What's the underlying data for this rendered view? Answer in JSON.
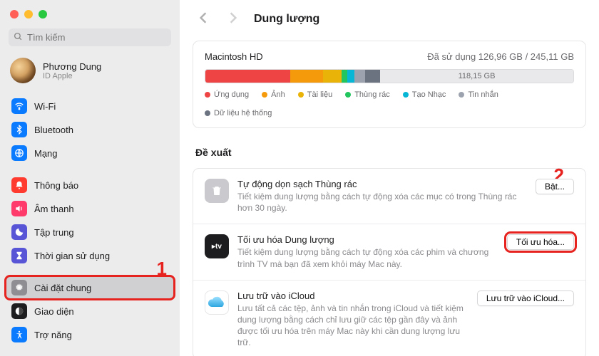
{
  "colors": {
    "red": "#ef4444",
    "orange": "#f59b0b",
    "yellow": "#eab308",
    "green": "#22c55e",
    "teal": "#06b6d4",
    "gray": "#9ca3af",
    "darkgray": "#6b7280"
  },
  "search": {
    "placeholder": "Tìm kiếm"
  },
  "account": {
    "name": "Phương Dung",
    "sub": "ID Apple"
  },
  "sidebar": {
    "items": [
      {
        "label": "Wi-Fi",
        "icon": "wifi",
        "bg": "#0a7aff"
      },
      {
        "label": "Bluetooth",
        "icon": "bluetooth",
        "bg": "#0a7aff"
      },
      {
        "label": "Mạng",
        "icon": "globe",
        "bg": "#0a7aff"
      },
      {
        "gap": true
      },
      {
        "label": "Thông báo",
        "icon": "bell",
        "bg": "#ff3b30"
      },
      {
        "label": "Âm thanh",
        "icon": "speaker",
        "bg": "#ff3b6b"
      },
      {
        "label": "Tập trung",
        "icon": "moon",
        "bg": "#5856d6"
      },
      {
        "label": "Thời gian sử dụng",
        "icon": "hourglass",
        "bg": "#5856d6"
      },
      {
        "gap": true
      },
      {
        "label": "Cài đặt chung",
        "icon": "gear",
        "bg": "#8e8e93",
        "selected": true,
        "highlight": true
      },
      {
        "label": "Giao diện",
        "icon": "appearance",
        "bg": "#1d1d1f"
      },
      {
        "label": "Trợ năng",
        "icon": "accessibility",
        "bg": "#0a7aff"
      }
    ]
  },
  "header": {
    "title": "Dung lượng"
  },
  "disk": {
    "name": "Macintosh HD",
    "used": "Đã sử dụng 126,96 GB / 245,11 GB",
    "free": "118,15 GB",
    "segments": [
      {
        "w": 23,
        "c": "#ef4444"
      },
      {
        "w": 9,
        "c": "#f59b0b"
      },
      {
        "w": 5,
        "c": "#eab308"
      },
      {
        "w": 1.5,
        "c": "#22c55e"
      },
      {
        "w": 2,
        "c": "#06b6d4"
      },
      {
        "w": 3,
        "c": "#9ca3af"
      },
      {
        "w": 4,
        "c": "#6b7280"
      }
    ],
    "legend": [
      {
        "label": "Ứng dụng",
        "c": "#ef4444"
      },
      {
        "label": "Ảnh",
        "c": "#f59b0b"
      },
      {
        "label": "Tài liệu",
        "c": "#eab308"
      },
      {
        "label": "Thùng rác",
        "c": "#22c55e"
      },
      {
        "label": "Tạo Nhạc",
        "c": "#06b6d4"
      },
      {
        "label": "Tin nhắn",
        "c": "#9ca3af"
      },
      {
        "label": "Dữ liệu hệ thống",
        "c": "#6b7280"
      }
    ]
  },
  "recs_title": "Đề xuất",
  "recs": [
    {
      "title": "Tự động dọn sạch Thùng rác",
      "desc": "Tiết kiệm dung lượng bằng cách tự động xóa các mục có trong Thùng rác hơn 30 ngày.",
      "button": "Bật...",
      "icon": "trash",
      "bg": "#c9c9ce"
    },
    {
      "title": "Tối ưu hóa Dung lượng",
      "desc": "Tiết kiệm dung lượng bằng cách tự động xóa các phim và chương trình TV mà bạn đã xem khỏi máy Mac này.",
      "button": "Tối ưu hóa...",
      "icon": "tv",
      "bg": "#1d1d1f",
      "highlight": true
    },
    {
      "title": "Lưu trữ vào iCloud",
      "desc": "Lưu tất cả các tệp, ảnh và tin nhắn trong iCloud và tiết kiệm dung lượng bằng cách chỉ lưu giữ các tệp gần đây và ảnh được tối ưu hóa trên máy Mac này khi cần dung lượng lưu trữ.",
      "button": "Lưu trữ vào iCloud...",
      "icon": "cloud",
      "bg": "#ffffff"
    }
  ],
  "markers": {
    "one": "1",
    "two": "2"
  }
}
